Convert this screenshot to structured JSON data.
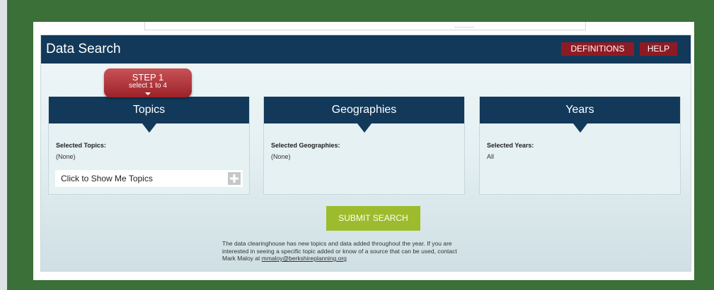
{
  "header": {
    "title": "Data Search",
    "definitions_label": "DEFINITIONS",
    "help_label": "HELP"
  },
  "top_strip": {
    "dots": "..........."
  },
  "step": {
    "title": "STEP 1",
    "subtitle": "select 1 to 4"
  },
  "cards": {
    "topics": {
      "title": "Topics",
      "selected_label": "Selected Topics:",
      "selected_value": "(None)",
      "show_button_label": "Click to Show Me Topics"
    },
    "geographies": {
      "title": "Geographies",
      "selected_label": "Selected Geographies:",
      "selected_value": "(None)"
    },
    "years": {
      "title": "Years",
      "selected_label": "Selected Years:",
      "selected_value": "All"
    }
  },
  "submit_label": "SUBMIT SEARCH",
  "note": {
    "line1": "The data clearinghouse has new topics and data added throughout the year. If you are",
    "line2": "interested in seeing a specific topic added or know of a source that can be used, contact",
    "line3_prefix": "Mark Maloy at",
    "email": "mmaloy@berkshireplanning.org"
  },
  "colors": {
    "page_bg": "#3b7038",
    "header_bg": "#13395a",
    "accent_red": "#8e1b24",
    "submit_green": "#9cbc2d"
  },
  "icons": [
    "plus-icon"
  ]
}
